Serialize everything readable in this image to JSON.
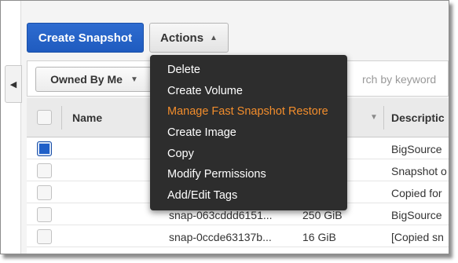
{
  "toolbar": {
    "create_label": "Create Snapshot",
    "actions_label": "Actions"
  },
  "filter": {
    "owned_label": "Owned By Me",
    "search_placeholder": "rch by keyword"
  },
  "table": {
    "col_name": "Name",
    "col_description": "Descriptic",
    "rows": [
      {
        "checked": true,
        "id": "",
        "size": "",
        "desc": "BigSource"
      },
      {
        "checked": false,
        "id": "",
        "size": "",
        "desc": "Snapshot o"
      },
      {
        "checked": false,
        "id": "",
        "size": "",
        "desc": "Copied for"
      },
      {
        "checked": false,
        "id": "snap-063cddd6151...",
        "size": "250 GiB",
        "desc": "BigSource"
      },
      {
        "checked": false,
        "id": "snap-0ccde63137b...",
        "size": "16 GiB",
        "desc": "[Copied sn"
      }
    ]
  },
  "menu": {
    "items": [
      "Delete",
      "Create Volume",
      "Manage Fast Snapshot Restore",
      "Create Image",
      "Copy",
      "Modify Permissions",
      "Add/Edit Tags"
    ],
    "active_index": 2
  },
  "colors": {
    "primary": "#1f5bbf",
    "menu_bg": "#2d2d2d",
    "menu_active": "#f28d2c"
  }
}
